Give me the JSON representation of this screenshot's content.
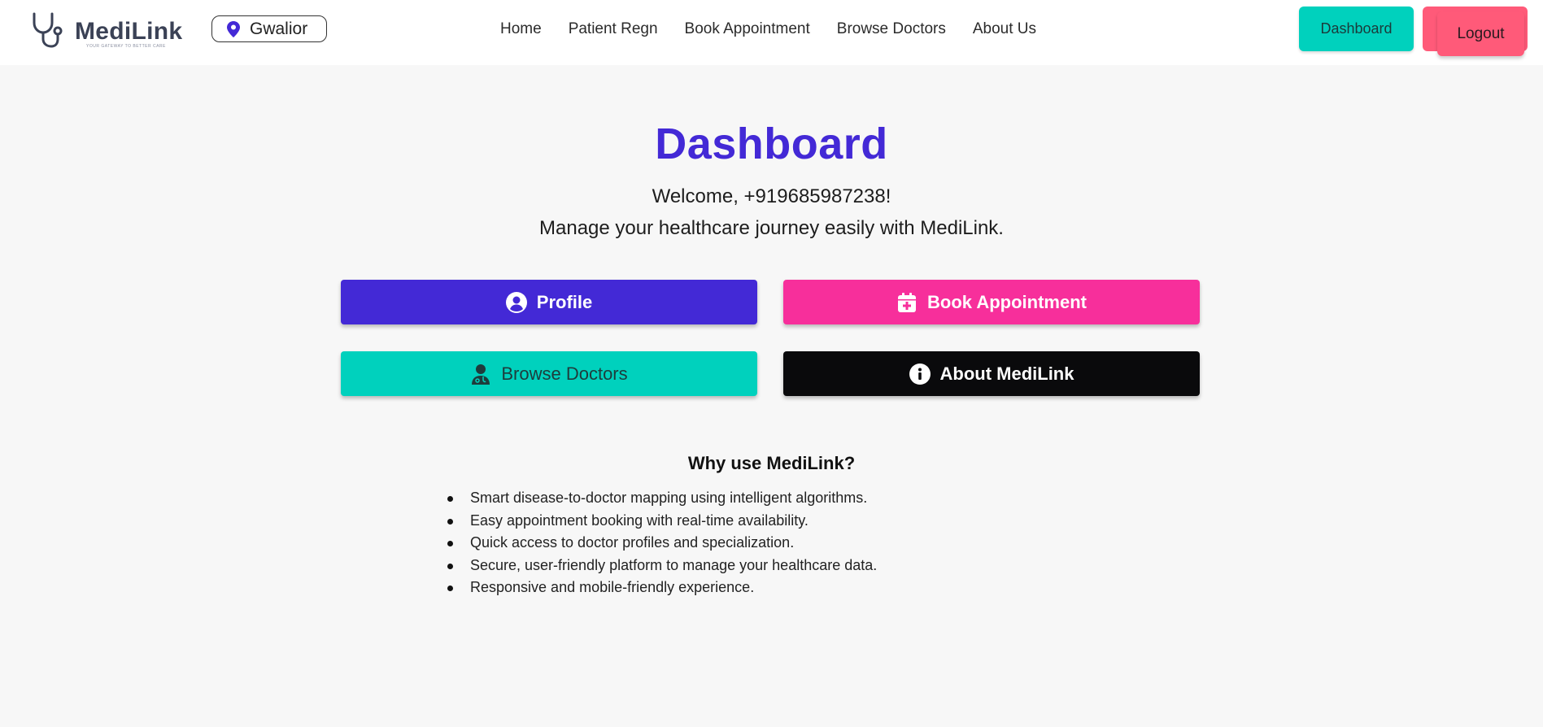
{
  "header": {
    "logo_text": "MediLink",
    "logo_tagline": "YOUR GATEWAY TO BETTER CARE",
    "location": "Gwalior",
    "nav": [
      "Home",
      "Patient Regn",
      "Book Appointment",
      "Browse Doctors",
      "About Us"
    ],
    "dashboard_label": "Dashboard",
    "logout_label": "Logout"
  },
  "main": {
    "title": "Dashboard",
    "welcome": "Welcome, +919685987238!",
    "subtitle": "Manage your healthcare journey easily with MediLink.",
    "buttons": {
      "profile": "Profile",
      "book": "Book Appointment",
      "browse": "Browse Doctors",
      "about": "About MediLink"
    },
    "why_title": "Why use MediLink?",
    "why_items": [
      "Smart disease-to-doctor mapping using intelligent algorithms.",
      "Easy appointment booking with real-time availability.",
      "Quick access to doctor profiles and specialization.",
      "Secure, user-friendly platform to manage your healthcare data.",
      "Responsive and mobile-friendly experience."
    ]
  },
  "colors": {
    "primary": "#4329d6",
    "pink": "#f72f9b",
    "teal": "#00d1bd",
    "black": "#0a0a0c",
    "logout": "#ff5a79"
  },
  "icons": {
    "logo": "stethoscope-icon",
    "location": "map-pin-icon",
    "profile": "user-circle-icon",
    "book": "calendar-plus-icon",
    "browse": "doctor-icon",
    "about": "info-circle-icon"
  }
}
